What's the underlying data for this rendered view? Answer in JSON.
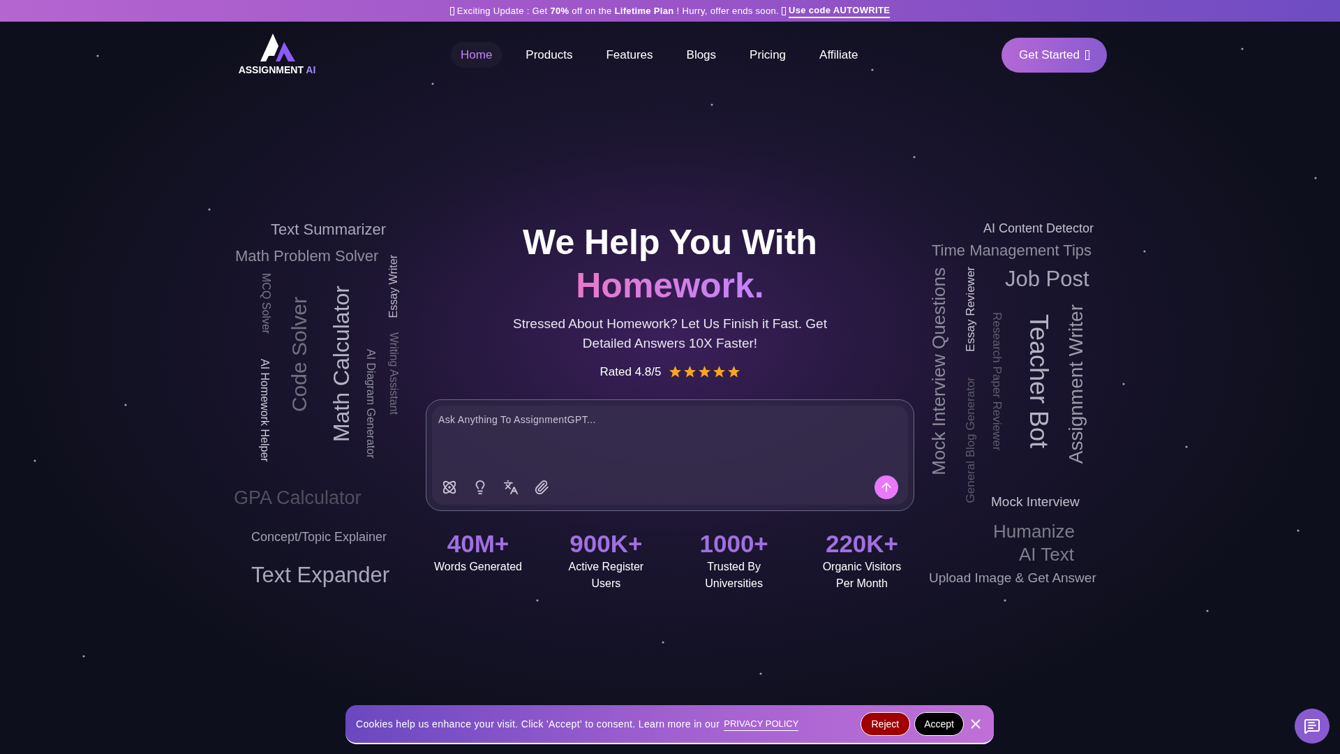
{
  "banner": {
    "text": "Exciting Update : Get **70%** off on the **Lifetime Plan** ! Hurry, offer ends soon.",
    "link": "Use code AUTOWRITE"
  },
  "logo": {
    "name": "ASSIGNMENT",
    "accent": "AI"
  },
  "nav": [
    {
      "label": "Home",
      "selected": true
    },
    {
      "label": "Products",
      "selected": false
    },
    {
      "label": "Features",
      "selected": false
    },
    {
      "label": "Blogs",
      "selected": false
    },
    {
      "label": "Pricing",
      "selected": false
    },
    {
      "label": "Affiliate",
      "selected": false
    }
  ],
  "cta": "Get Started",
  "hero": {
    "title": "We Help You With",
    "highlight": "Homework.",
    "subtitle": "Stressed About Homework? Let Us Finish it Fast. Get Detailed Answers 10X Faster!",
    "rating": "Rated 4.8/5",
    "stars": 5
  },
  "ask": {
    "placeholder": "Ask Anything To AssignmentGPT..."
  },
  "stats": [
    {
      "value": "40M+",
      "label": "Words Generated"
    },
    {
      "value": "900K+",
      "label": "Active Register Users"
    },
    {
      "value": "1000+",
      "label": "Trusted By Universities"
    },
    {
      "value": "220K+",
      "label": "Organic Visitors Per Month"
    }
  ],
  "left_cloud": [
    {
      "text": "Text Summarizer",
      "kind": "horizontal"
    },
    {
      "text": "Math Problem Solver",
      "kind": "horizontal"
    },
    {
      "text": "MCQ Solver",
      "kind": "down"
    },
    {
      "text": "AI Homework Helper",
      "kind": "down"
    },
    {
      "text": "Code Solver",
      "kind": "up"
    },
    {
      "text": "Math Calculator",
      "kind": "up"
    },
    {
      "text": "AI Diagram Generator",
      "kind": "down"
    },
    {
      "text": "Essay Writer",
      "kind": "up"
    },
    {
      "text": "Writing Assistant",
      "kind": "down"
    },
    {
      "text": "GPA Calculator",
      "kind": "horizontal"
    },
    {
      "text": "Concept/Topic Explainer",
      "kind": "horizontal"
    },
    {
      "text": "Text Expander",
      "kind": "horizontal"
    }
  ],
  "right_cloud": [
    {
      "text": "AI Content Detector",
      "kind": "horizontal"
    },
    {
      "text": "Time Management Tips",
      "kind": "horizontal"
    },
    {
      "text": "Job Post",
      "kind": "horizontal"
    },
    {
      "text": "Mock Interview Questions",
      "kind": "up"
    },
    {
      "text": "Essay Reviewer",
      "kind": "up"
    },
    {
      "text": "General Blog Generator",
      "kind": "up"
    },
    {
      "text": "Research Paper Reviewer",
      "kind": "down"
    },
    {
      "text": "Teacher Bot",
      "kind": "down"
    },
    {
      "text": "Assignment Writer",
      "kind": "up"
    },
    {
      "text": "Mock Interview",
      "kind": "horizontal"
    },
    {
      "text": "Humanize",
      "kind": "horizontal"
    },
    {
      "text": "AI Text",
      "kind": "horizontal"
    },
    {
      "text": "Upload Image & Get Answer",
      "kind": "horizontal"
    }
  ],
  "cookie": {
    "text": "Cookies help us enhance your visit. Click 'Accept' to consent. Learn more in our",
    "link": "PRIVACY POLICY",
    "reject": "Reject",
    "accept": "Accept"
  }
}
